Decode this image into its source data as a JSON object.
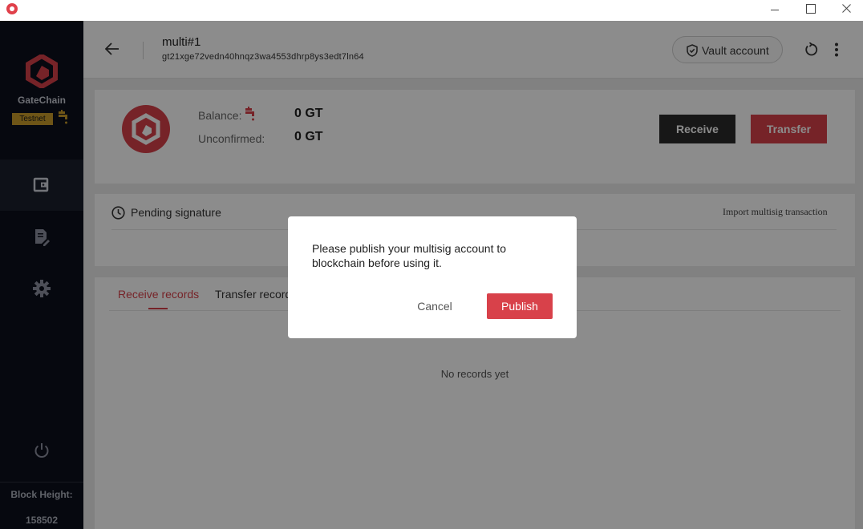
{
  "colors": {
    "accent": "#d8414a",
    "sidebar_bg": "#0c0f1c",
    "testnet_badge": "#c89b2a",
    "dark_button": "#2a2a2a"
  },
  "sidebar": {
    "brand": "GateChain",
    "network_badge": "Testnet",
    "nav": [
      {
        "name": "wallet",
        "icon": "wallet-icon",
        "active": true
      },
      {
        "name": "transactions",
        "icon": "edit-document-icon",
        "active": false
      },
      {
        "name": "settings",
        "icon": "gear-icon",
        "active": false
      }
    ],
    "block_height_label": "Block Height:",
    "block_height_value": "158502"
  },
  "header": {
    "account_name": "multi#1",
    "account_address": "gt21xge72vedn40hnqz3wa4553dhrp8ys3edt7ln64",
    "vault_button": "Vault account"
  },
  "balance": {
    "balance_label": "Balance:",
    "balance_value": "0 GT",
    "unconfirmed_label": "Unconfirmed:",
    "unconfirmed_value": "0 GT",
    "receive_button": "Receive",
    "transfer_button": "Transfer"
  },
  "pending": {
    "title": "Pending signature",
    "import_link": "Import multisig transaction"
  },
  "records": {
    "tabs": [
      "Receive records",
      "Transfer records"
    ],
    "active_tab": "Receive records",
    "empty_text": "No records yet"
  },
  "modal": {
    "message": "Please publish your multisig account to blockchain before using it.",
    "cancel_button": "Cancel",
    "publish_button": "Publish"
  }
}
